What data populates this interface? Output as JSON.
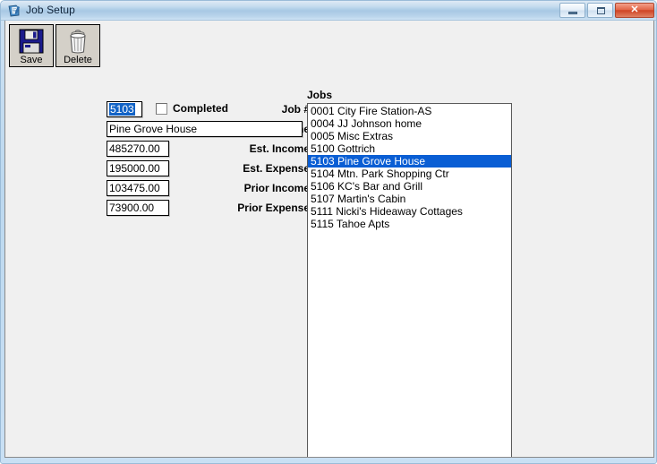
{
  "window": {
    "title": "Job Setup",
    "icon": "app-document-icon",
    "controls": {
      "minimize": "minimize-button",
      "maximize": "maximize-button",
      "close_glyph": "✕"
    }
  },
  "toolbar": {
    "buttons": [
      {
        "label": "Save",
        "icon": "floppy-disk-save-icon"
      },
      {
        "label": "Delete",
        "icon": "trash-can-delete-icon"
      }
    ]
  },
  "form": {
    "fields": [
      {
        "label": "Job #",
        "value": "5103",
        "selected": true
      },
      {
        "label": "Name",
        "value": "Pine Grove House",
        "selected": false
      },
      {
        "label": "Est. Income",
        "value": "485270.00",
        "selected": false
      },
      {
        "label": "Est. Expense",
        "value": "195000.00",
        "selected": false
      },
      {
        "label": "Prior Income",
        "value": "103475.00",
        "selected": false
      },
      {
        "label": "Prior Expense",
        "value": "73900.00",
        "selected": false
      }
    ],
    "completed": {
      "label": "Completed",
      "checked": false
    }
  },
  "jobs": {
    "label": "Jobs",
    "items": [
      {
        "text": "0001 City Fire Station-AS",
        "selected": false
      },
      {
        "text": "0004 JJ Johnson home",
        "selected": false
      },
      {
        "text": "0005 Misc Extras",
        "selected": false
      },
      {
        "text": "5100 Gottrich",
        "selected": false
      },
      {
        "text": "5103 Pine Grove House",
        "selected": true
      },
      {
        "text": "5104 Mtn. Park Shopping Ctr",
        "selected": false
      },
      {
        "text": "5106 KC's Bar and Grill",
        "selected": false
      },
      {
        "text": "5107 Martin's Cabin",
        "selected": false
      },
      {
        "text": "5111 Nicki's Hideaway Cottages",
        "selected": false
      },
      {
        "text": "5115 Tahoe Apts",
        "selected": false
      }
    ]
  },
  "colors": {
    "selection_blue": "#0a5ed4",
    "client_background": "#f0f0f0",
    "titlebar_blue": "#a8c8e4",
    "close_red": "#cf4425",
    "save_icon_navy": "#1a1a8c"
  }
}
